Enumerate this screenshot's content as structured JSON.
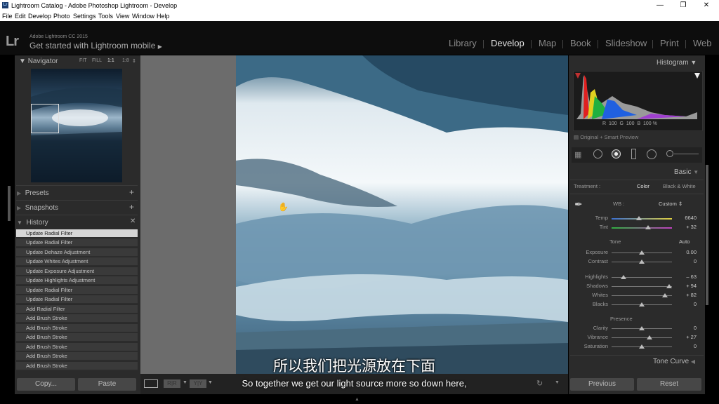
{
  "window": {
    "title": "Lightroom Catalog - Adobe Photoshop Lightroom - Develop",
    "app_icon": "Lr"
  },
  "menu": [
    "File",
    "Edit",
    "Develop",
    "Photo",
    "Settings",
    "Tools",
    "View",
    "Window",
    "Help"
  ],
  "identity": {
    "logo": "Lr",
    "version": "Adobe Lightroom CC 2015",
    "mobile": "Get started with Lightroom mobile"
  },
  "modules": [
    "Library",
    "Develop",
    "Map",
    "Book",
    "Slideshow",
    "Print",
    "Web"
  ],
  "active_module": "Develop",
  "navigator": {
    "title": "Navigator",
    "zoom_options": [
      "FIT",
      "FILL",
      "1:1",
      "1:8"
    ]
  },
  "left_sections": {
    "presets": "Presets",
    "snapshots": "Snapshots",
    "history": "History"
  },
  "history": [
    "Update Radial Filter",
    "Update Radial Filter",
    "Update Dehaze Adjustment",
    "Update Whites Adjustment",
    "Update Exposure Adjustment",
    "Update Highlights Adjustment",
    "Update Radial Filter",
    "Update Radial Filter",
    "Add Radial Filter",
    "Add Brush Stroke",
    "Add Brush Stroke",
    "Add Brush Stroke",
    "Add Brush Stroke",
    "Add Brush Stroke",
    "Add Brush Stroke"
  ],
  "left_buttons": {
    "copy": "Copy...",
    "paste": "Paste"
  },
  "toolbar": {
    "compare_ab": "R|R",
    "compare_yy": "Y|Y"
  },
  "subtitles": {
    "zh": "所以我们把光源放在下面",
    "en": "So together we get our light source more so down here,"
  },
  "histogram": {
    "title": "Histogram",
    "readout": {
      "r_label": "R",
      "r": "100",
      "g_label": "G",
      "g": "100",
      "b_label": "B",
      "b": "100",
      "pct": "%"
    },
    "preview_label": "Original + Smart Preview"
  },
  "basic": {
    "title": "Basic",
    "treatment_label": "Treatment :",
    "treatment_color": "Color",
    "treatment_bw": "Black & White",
    "wb_label": "WB :",
    "wb_value": "Custom",
    "tone_label": "Tone",
    "auto_label": "Auto",
    "presence_label": "Presence",
    "sliders": [
      {
        "label": "Temp",
        "value": "6640",
        "pos": 0.45
      },
      {
        "label": "Tint",
        "value": "+ 32",
        "pos": 0.6
      },
      {
        "label": "Exposure",
        "value": "0.00",
        "pos": 0.5
      },
      {
        "label": "Contrast",
        "value": "0",
        "pos": 0.5
      },
      {
        "label": "Highlights",
        "value": "– 63",
        "pos": 0.2
      },
      {
        "label": "Shadows",
        "value": "+ 94",
        "pos": 0.95
      },
      {
        "label": "Whites",
        "value": "+ 82",
        "pos": 0.88
      },
      {
        "label": "Blacks",
        "value": "0",
        "pos": 0.5
      },
      {
        "label": "Clarity",
        "value": "0",
        "pos": 0.5
      },
      {
        "label": "Vibrance",
        "value": "+ 27",
        "pos": 0.63
      },
      {
        "label": "Saturation",
        "value": "0",
        "pos": 0.5
      }
    ]
  },
  "tone_curve": {
    "title": "Tone Curve"
  },
  "right_buttons": {
    "previous": "Previous",
    "reset": "Reset"
  }
}
